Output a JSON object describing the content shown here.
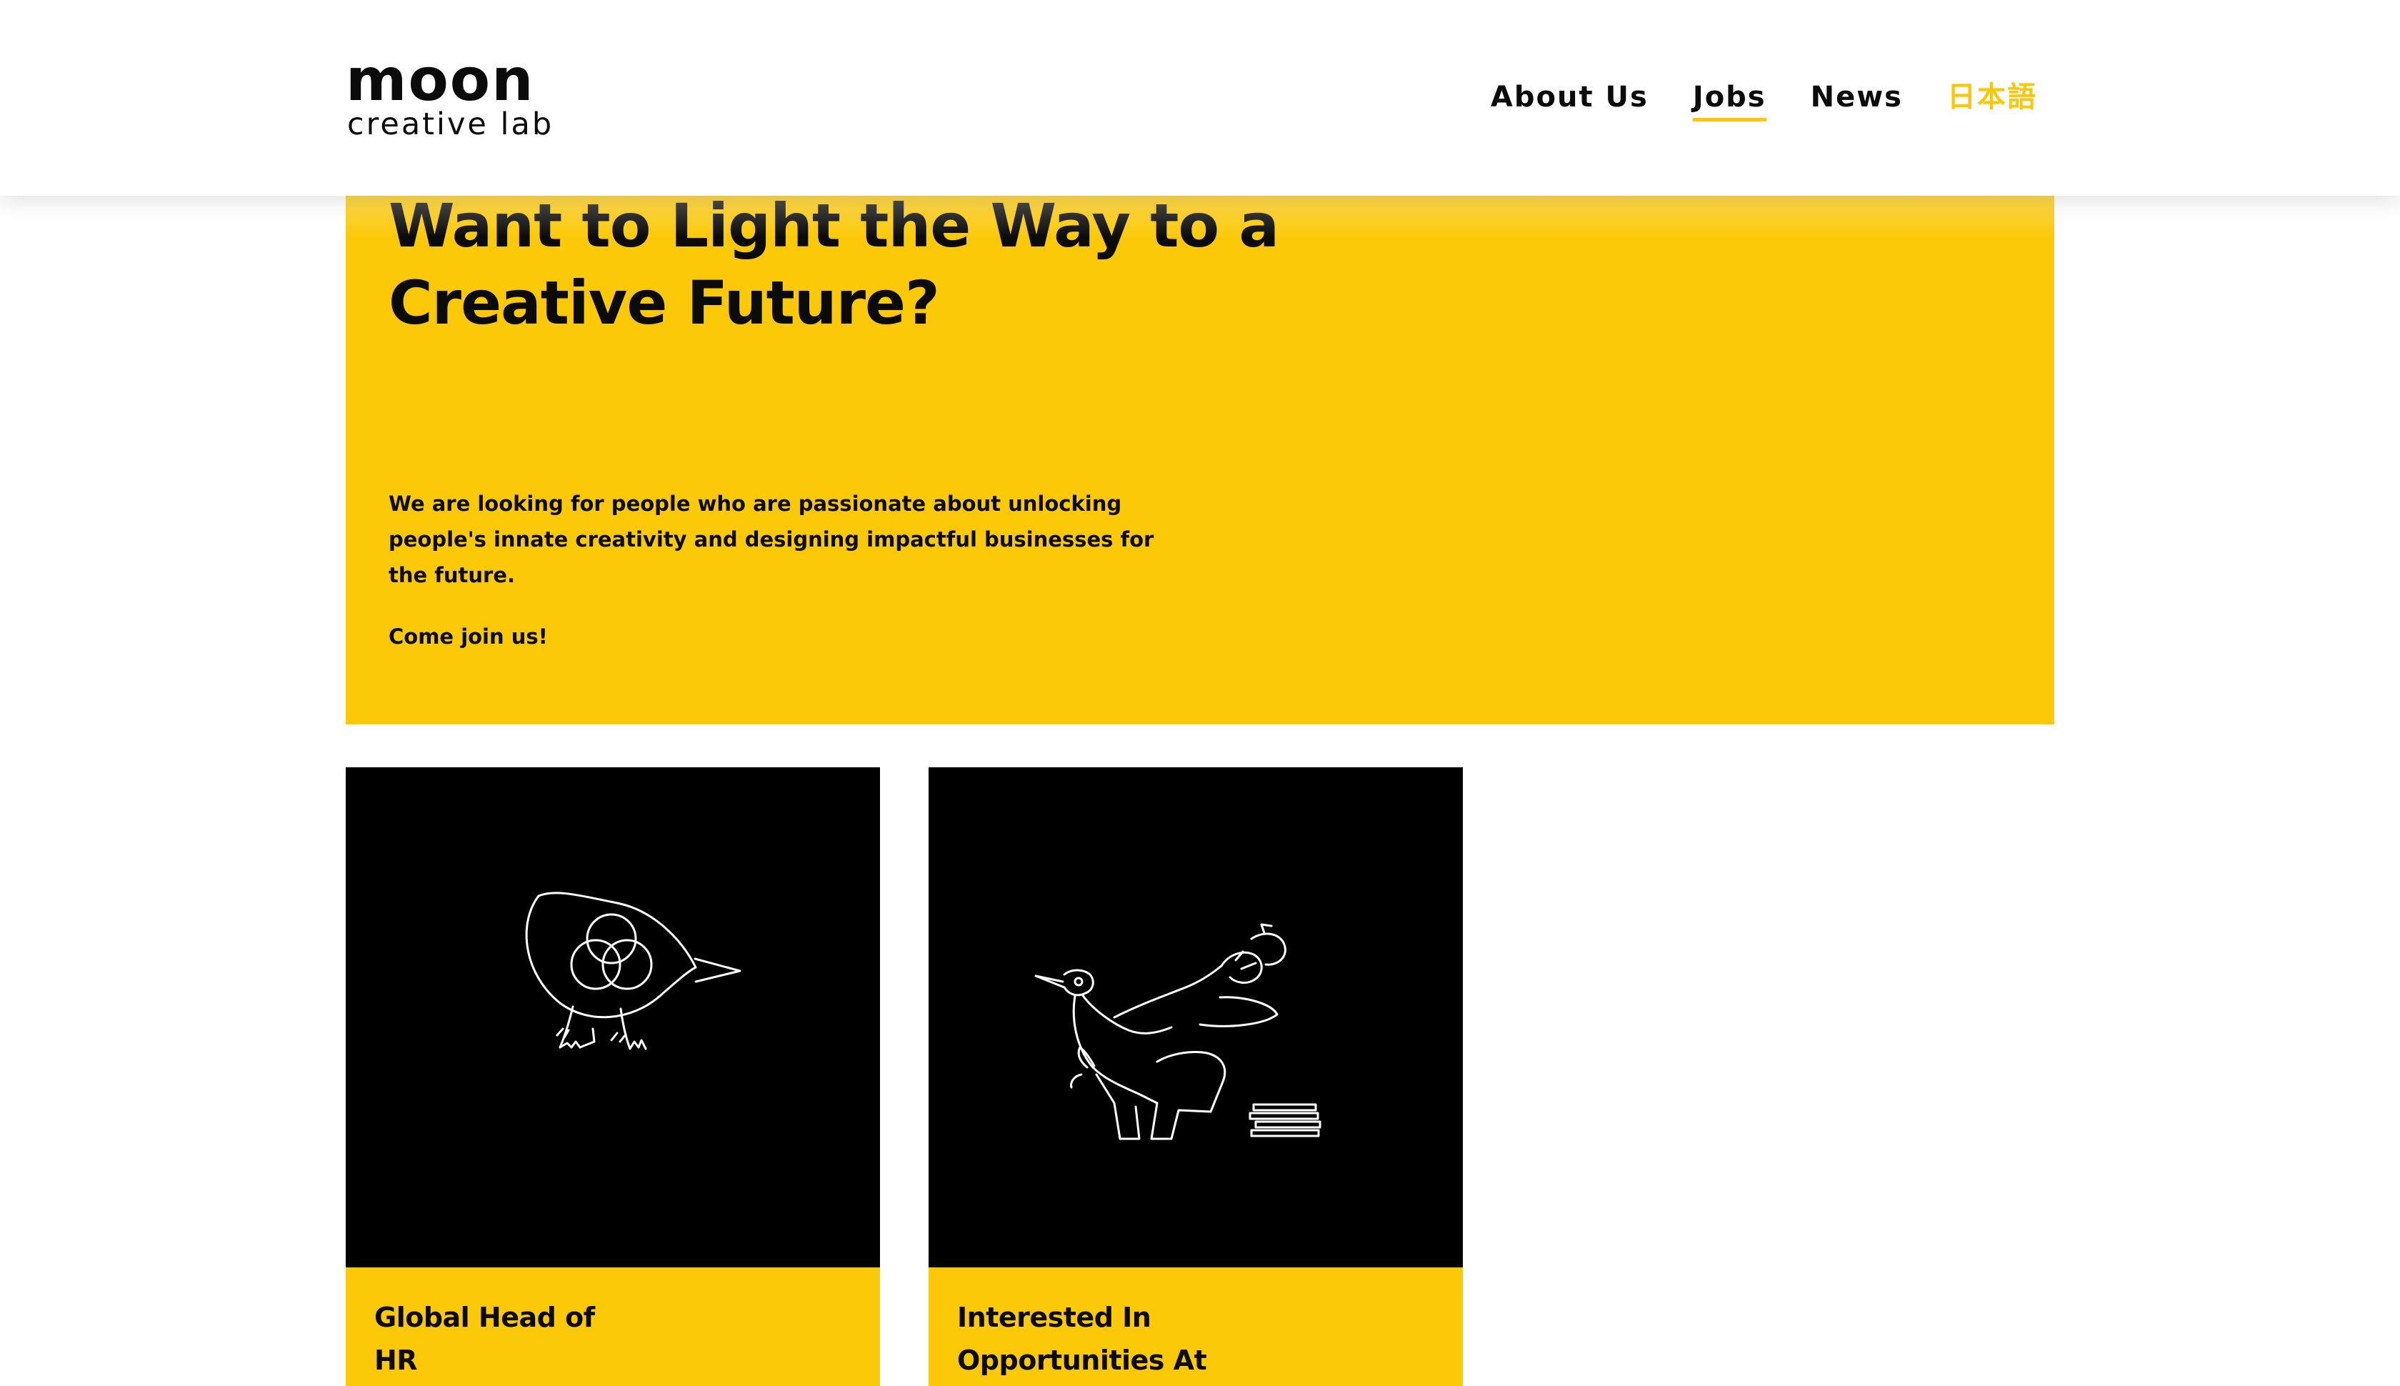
{
  "header": {
    "logo_main": "moon",
    "logo_sub": "creative lab",
    "nav": [
      {
        "label": "About Us",
        "active": false
      },
      {
        "label": "Jobs",
        "active": true
      },
      {
        "label": "News",
        "active": false
      },
      {
        "label": "日本語",
        "active": false
      }
    ]
  },
  "hero": {
    "title": "Want to Light the Way to a\nCreative Future?",
    "text": "We are looking for people who are passionate about unlocking people's innate creativity and designing impactful businesses for the future.",
    "cta": "Come join us!"
  },
  "jobs": [
    {
      "title": "Global Head of\nHR",
      "illustration": "bird-with-circles-illustration"
    },
    {
      "title": "Interested In\nOpportunities At",
      "illustration": "figure-with-lamp-illustration"
    }
  ],
  "colors": {
    "accent": "#fcc909",
    "text": "#0b0b0b",
    "card_image_bg": "#000000"
  }
}
